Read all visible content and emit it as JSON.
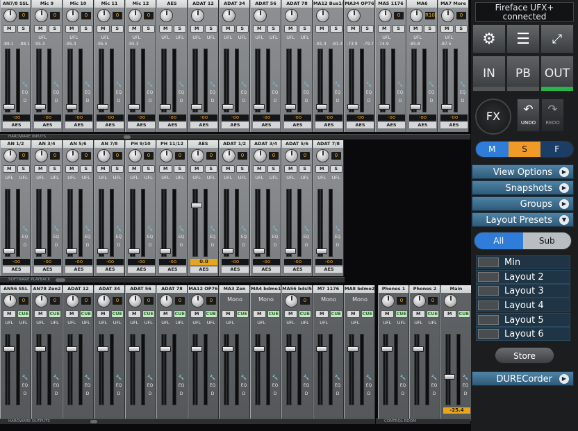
{
  "device": "Fireface UFX+ connected",
  "rows": [
    {
      "section": "HARDWARE INPUTS",
      "channels": [
        {
          "name": "AN7/8 SSL",
          "gain": "0",
          "ms": [
            "M",
            "S"
          ],
          "ufl": [
            "",
            ""
          ],
          "lv": [
            "-89.1",
            "-88.1"
          ],
          "vol": "-oo",
          "out": "AES"
        },
        {
          "name": "Mic 9",
          "gain": "0",
          "ms": [
            "M",
            "S"
          ],
          "ufl": [
            "UFL",
            ""
          ],
          "lv": [
            "-95.3",
            ""
          ],
          "vol": "-oo",
          "out": "AES"
        },
        {
          "name": "Mic 10",
          "gain": "0",
          "ms": [
            "M",
            "S"
          ],
          "ufl": [
            "UFL",
            ""
          ],
          "lv": [
            "-95.3",
            ""
          ],
          "vol": "-oo",
          "out": "AES"
        },
        {
          "name": "Mic 11",
          "gain": "0",
          "ms": [
            "M",
            "S"
          ],
          "ufl": [
            "UFL",
            ""
          ],
          "lv": [
            "-95.5",
            ""
          ],
          "vol": "-oo",
          "out": "AES"
        },
        {
          "name": "Mic 12",
          "gain": "0",
          "ms": [
            "M",
            "S"
          ],
          "ufl": [
            "UFL",
            ""
          ],
          "lv": [
            "-95.3",
            ""
          ],
          "vol": "-oo",
          "out": "AES"
        },
        {
          "name": "AES",
          "gain": "",
          "ms": [
            "M",
            "S"
          ],
          "ufl": [
            "UFL",
            "UFL"
          ],
          "lv": [
            "",
            ""
          ],
          "vol": "-oo",
          "out": "AES"
        },
        {
          "name": "ADAT 12",
          "gain": "",
          "ms": [
            "M",
            "S"
          ],
          "ufl": [
            "UFL",
            "UFL"
          ],
          "lv": [
            "",
            ""
          ],
          "vol": "-oo",
          "out": "AES"
        },
        {
          "name": "ADAT 34",
          "gain": "",
          "ms": [
            "M",
            "S"
          ],
          "ufl": [
            "UFL",
            "UFL"
          ],
          "lv": [
            "",
            ""
          ],
          "vol": "-oo",
          "out": "AES"
        },
        {
          "name": "ADAT 56",
          "gain": "",
          "ms": [
            "M",
            "S"
          ],
          "ufl": [
            "UFL",
            "UFL"
          ],
          "lv": [
            "",
            ""
          ],
          "vol": "-oo",
          "out": "AES"
        },
        {
          "name": "ADAT 78",
          "gain": "",
          "ms": [
            "M",
            "S"
          ],
          "ufl": [
            "UFL",
            "UFL"
          ],
          "lv": [
            "",
            ""
          ],
          "vol": "-oo",
          "out": "AES"
        },
        {
          "name": "MA12 Bus1/2",
          "gain": "",
          "ms": [
            "M",
            "S"
          ],
          "ufl": [
            "",
            ""
          ],
          "lv": [
            "-81.4",
            "-81.3"
          ],
          "vol": "-oo",
          "out": "AES"
        },
        {
          "name": "MA34 OP76",
          "gain": "",
          "ms": [
            "M",
            "S"
          ],
          "ufl": [
            "",
            ""
          ],
          "lv": [
            "-73.9",
            "-79.7"
          ],
          "vol": "-oo",
          "out": "AES"
        },
        {
          "name": "MA5 1176",
          "gain": "0",
          "ms": [
            "M",
            "S"
          ],
          "ufl": [
            "UFL",
            ""
          ],
          "lv": [
            "-74.9",
            ""
          ],
          "vol": "-oo",
          "out": "AES"
        },
        {
          "name": "MA6",
          "gain": "R100",
          "ms": [
            "M",
            "S"
          ],
          "ufl": [
            "UFL",
            ""
          ],
          "lv": [
            "-85.8",
            ""
          ],
          "vol": "-oo",
          "out": "AES"
        },
        {
          "name": "MA7 More",
          "gain": "0",
          "ms": [
            "M",
            "S"
          ],
          "ufl": [
            "UFL",
            ""
          ],
          "lv": [
            "-87.5",
            ""
          ],
          "vol": "-oo",
          "out": "AES"
        }
      ]
    },
    {
      "section": "SOFTWARE PLAYBACK",
      "channels": [
        {
          "name": "AN 1/2",
          "gain": "0",
          "ms": [
            "M",
            "S"
          ],
          "ufl": [
            "UFL",
            "UFL"
          ],
          "lv": [
            "",
            ""
          ],
          "vol": "-oo",
          "out": "AES"
        },
        {
          "name": "AN 3/4",
          "gain": "0",
          "ms": [
            "M",
            "S"
          ],
          "ufl": [
            "UFL",
            "UFL"
          ],
          "lv": [
            "",
            ""
          ],
          "vol": "-oo",
          "out": "AES"
        },
        {
          "name": "AN 5/6",
          "gain": "0",
          "ms": [
            "M",
            "S"
          ],
          "ufl": [
            "UFL",
            "UFL"
          ],
          "lv": [
            "",
            ""
          ],
          "vol": "-oo",
          "out": "AES"
        },
        {
          "name": "AN 7/8",
          "gain": "0",
          "ms": [
            "M",
            "S"
          ],
          "ufl": [
            "UFL",
            "UFL"
          ],
          "lv": [
            "",
            ""
          ],
          "vol": "-oo",
          "out": "AES"
        },
        {
          "name": "PH 9/10",
          "gain": "0",
          "ms": [
            "M",
            "S"
          ],
          "ufl": [
            "UFL",
            "UFL"
          ],
          "lv": [
            "",
            ""
          ],
          "vol": "-oo",
          "out": "AES"
        },
        {
          "name": "PH 11/12",
          "gain": "0",
          "ms": [
            "M",
            "S"
          ],
          "ufl": [
            "UFL",
            "UFL"
          ],
          "lv": [
            "",
            ""
          ],
          "vol": "-oo",
          "out": "AES"
        },
        {
          "name": "AES",
          "gain": "0",
          "ms": [
            "M",
            "S"
          ],
          "ufl": [
            "UFL",
            "UFL"
          ],
          "lv": [
            "",
            ""
          ],
          "vol": "0.0",
          "out": "AES"
        },
        {
          "name": "ADAT 1/2",
          "gain": "0",
          "ms": [
            "M",
            "S"
          ],
          "ufl": [
            "UFL",
            "UFL"
          ],
          "lv": [
            "",
            ""
          ],
          "vol": "-oo",
          "out": "AES"
        },
        {
          "name": "ADAT 3/4",
          "gain": "0",
          "ms": [
            "M",
            "S"
          ],
          "ufl": [
            "UFL",
            "UFL"
          ],
          "lv": [
            "",
            ""
          ],
          "vol": "-oo",
          "out": "AES"
        },
        {
          "name": "ADAT 5/6",
          "gain": "0",
          "ms": [
            "M",
            "S"
          ],
          "ufl": [
            "UFL",
            "UFL"
          ],
          "lv": [
            "",
            ""
          ],
          "vol": "-oo",
          "out": "AES"
        },
        {
          "name": "ADAT 7/8",
          "gain": "0",
          "ms": [
            "M",
            "S"
          ],
          "ufl": [
            "UFL",
            "UFL"
          ],
          "lv": [
            "",
            ""
          ],
          "vol": "-oo",
          "out": "AES"
        }
      ]
    },
    {
      "section": "HARDWARE OUTPUTS",
      "channels": [
        {
          "name": "AN56 SSL",
          "gain": "0",
          "ms": [
            "M",
            "CUE"
          ],
          "ufl": [
            "UFL",
            "UFL"
          ],
          "lv": [
            "",
            ""
          ],
          "vol": "",
          "out": ""
        },
        {
          "name": "AN78 Zen2",
          "gain": "0",
          "ms": [
            "M",
            "CUE"
          ],
          "ufl": [
            "UFL",
            "UFL"
          ],
          "lv": [
            "",
            ""
          ],
          "vol": "",
          "out": ""
        },
        {
          "name": "ADAT 12",
          "gain": "0",
          "ms": [
            "M",
            "CUE"
          ],
          "ufl": [
            "UFL",
            "UFL"
          ],
          "lv": [
            "",
            ""
          ],
          "vol": "",
          "out": ""
        },
        {
          "name": "ADAT 34",
          "gain": "0",
          "ms": [
            "M",
            "CUE"
          ],
          "ufl": [
            "UFL",
            "UFL"
          ],
          "lv": [
            "",
            ""
          ],
          "vol": "",
          "out": ""
        },
        {
          "name": "ADAT 56",
          "gain": "0",
          "ms": [
            "M",
            "CUE"
          ],
          "ufl": [
            "UFL",
            "UFL"
          ],
          "lv": [
            "",
            ""
          ],
          "vol": "",
          "out": ""
        },
        {
          "name": "ADAT 78",
          "gain": "0",
          "ms": [
            "M",
            "CUE"
          ],
          "ufl": [
            "UFL",
            "UFL"
          ],
          "lv": [
            "",
            ""
          ],
          "vol": "",
          "out": ""
        },
        {
          "name": "MA12 OP76",
          "gain": "0",
          "ms": [
            "M",
            "CUE"
          ],
          "ufl": [
            "UFL",
            "UFL"
          ],
          "lv": [
            "",
            ""
          ],
          "vol": "",
          "out": ""
        },
        {
          "name": "MA3 Zen",
          "mono": "Mono",
          "ms": [
            "M",
            "CUE"
          ],
          "ufl": [
            "UFL",
            ""
          ],
          "lv": [
            "",
            ""
          ],
          "vol": "",
          "out": ""
        },
        {
          "name": "MA4 bdmo1",
          "mono": "Mono",
          "ms": [
            "M",
            "CUE"
          ],
          "ufl": [
            "UFL",
            ""
          ],
          "lv": [
            "",
            ""
          ],
          "vol": "",
          "out": ""
        },
        {
          "name": "MA56 bdsl5",
          "gain": "0",
          "ms": [
            "M",
            "CUE"
          ],
          "ufl": [
            "UFL",
            "UFL"
          ],
          "lv": [
            "",
            ""
          ],
          "vol": "",
          "out": ""
        },
        {
          "name": "M7 1176",
          "mono": "Mono",
          "ms": [
            "M",
            "CUE"
          ],
          "ufl": [
            "UFL",
            ""
          ],
          "lv": [
            "",
            ""
          ],
          "vol": "",
          "out": ""
        },
        {
          "name": "MA8 bdmo2",
          "mono": "Mono",
          "ms": [
            "M",
            "CUE"
          ],
          "ufl": [
            "UFL",
            ""
          ],
          "lv": [
            "",
            ""
          ],
          "vol": "",
          "out": ""
        },
        {
          "name": "Phones 1",
          "gain": "0",
          "ms": [
            "M",
            "CUE"
          ],
          "ufl": [
            "UFL",
            "UFL"
          ],
          "lv": [
            "",
            ""
          ],
          "vol": "",
          "out": ""
        },
        {
          "name": "Phones 2",
          "gain": "0",
          "ms": [
            "M",
            "CUE"
          ],
          "ufl": [
            "UFL",
            "UFL"
          ],
          "lv": [
            "",
            ""
          ],
          "vol": "",
          "out": ""
        },
        {
          "name": "Main",
          "gain": "",
          "ms": [
            "M",
            "CUE"
          ],
          "ufl": [
            "",
            ""
          ],
          "lv": [
            "",
            ""
          ],
          "vol": "-25.4",
          "out": ""
        }
      ]
    }
  ],
  "control_room": "CONTROL ROOM",
  "toolbar": {
    "io": [
      "IN",
      "PB",
      "OUT"
    ],
    "fx": "FX",
    "undo": "UNDO",
    "redo": "REDO",
    "msf": [
      "M",
      "S",
      "F"
    ]
  },
  "options": [
    "View Options",
    "Snapshots",
    "Groups",
    "Layout Presets"
  ],
  "layout_tabs": [
    "All",
    "Sub"
  ],
  "presets": [
    "Min",
    "Layout 2",
    "Layout 3",
    "Layout 4",
    "Layout 5",
    "Layout 6"
  ],
  "store": "Store",
  "durec": "DURECorder"
}
